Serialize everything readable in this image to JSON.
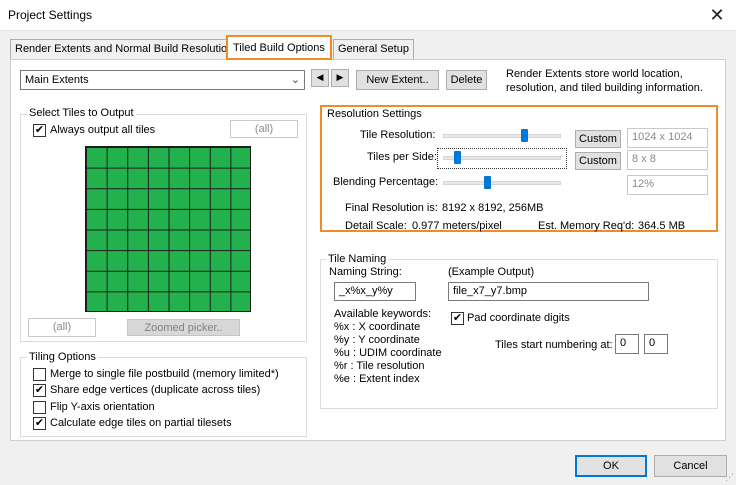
{
  "window": {
    "title": "Project Settings",
    "close_glyph": "✕"
  },
  "tabs": [
    {
      "label": "Render Extents and Normal Build Resolution"
    },
    {
      "label": "Tiled Build Options"
    },
    {
      "label": "General Setup"
    }
  ],
  "extents": {
    "selected": "Main Extents",
    "prev_glyph": "◀",
    "next_glyph": "▶",
    "new_label": "New Extent..",
    "delete_label": "Delete",
    "info_text": "Render Extents store world location, resolution, and tiled building information."
  },
  "select_tiles": {
    "title": "Select Tiles to Output",
    "always_output_label": "Always output all tiles",
    "always_output_checked": true,
    "all_top_label": "(all)",
    "all_bottom_label": "(all)",
    "zoomed_picker_label": "Zoomed picker..",
    "grid_fill_color": "#23b14d"
  },
  "tiling_options": {
    "title": "Tiling Options",
    "options": [
      {
        "label": "Merge to single file postbuild (memory limited*)",
        "checked": false
      },
      {
        "label": "Share edge vertices (duplicate across tiles)",
        "checked": true
      },
      {
        "label": "Flip Y-axis orientation",
        "checked": false
      },
      {
        "label": "Calculate edge tiles on partial tilesets",
        "checked": true
      }
    ]
  },
  "resolution": {
    "title": "Resolution Settings",
    "tile_resolution_label": "Tile Resolution:",
    "tile_resolution_custom": "Custom",
    "tile_resolution_value": "1024 x 1024",
    "tile_resolution_level": 0.69,
    "tiles_per_side_label": "Tiles per Side:",
    "tiles_per_side_custom": "Custom",
    "tiles_per_side_value": "8 x 8",
    "tiles_per_side_level": 0.12,
    "blending_label": "Blending Percentage:",
    "blending_value": "12%",
    "blending_level": 0.38,
    "final_label": "Final Resolution is:",
    "final_value": "8192 x 8192, 256MB",
    "detail_label": "Detail Scale:",
    "detail_value": "0.977 meters/pixel",
    "memory_label": "Est. Memory Req'd:",
    "memory_value": "364.5 MB"
  },
  "tile_naming": {
    "title": "Tile Naming",
    "naming_string_label": "Naming String:",
    "naming_string_value": "_x%x_y%y",
    "example_label": "(Example Output)",
    "example_value": "file_x7_y7.bmp",
    "keywords_title": "Available keywords:",
    "keywords": [
      "%x : X coordinate",
      "%y : Y coordinate",
      "%u : UDIM coordinate",
      "%r : Tile resolution",
      "%e : Extent index"
    ],
    "pad_label": "Pad coordinate digits",
    "pad_checked": true,
    "start_label": "Tiles start numbering at:",
    "start_x": "0",
    "start_y": "0"
  },
  "footer": {
    "ok_label": "OK",
    "cancel_label": "Cancel"
  },
  "colors": {
    "accent": "#0078d7",
    "highlight": "#f08c28",
    "tile": "#23b14d"
  }
}
